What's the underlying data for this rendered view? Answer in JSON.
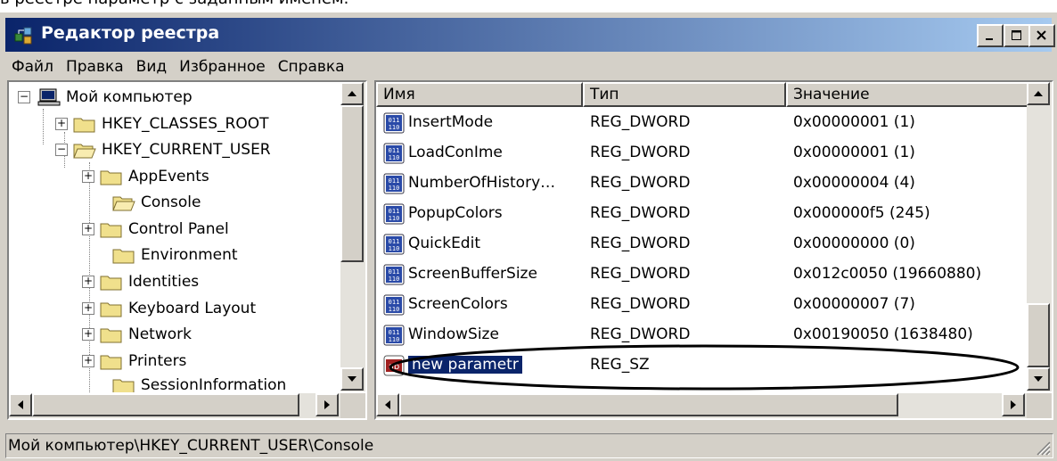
{
  "doc_fragment": "в реестре параметр с заданным именем.",
  "window": {
    "title": "Редактор реестра",
    "controls": {
      "minimize": "_",
      "maximize": "□",
      "close": "×"
    }
  },
  "menu": [
    "Файл",
    "Правка",
    "Вид",
    "Избранное",
    "Справка"
  ],
  "tree": {
    "root": "Мой компьютер",
    "hkcr": "HKEY_CLASSES_ROOT",
    "hkcu": "HKEY_CURRENT_USER",
    "children": [
      "AppEvents",
      "Console",
      "Control Panel",
      "Environment",
      "Identities",
      "Keyboard Layout",
      "Network",
      "Printers",
      "SessionInformation"
    ]
  },
  "list": {
    "headers": {
      "name": "Имя",
      "type": "Тип",
      "value": "Значение"
    },
    "rows": [
      {
        "name": "InsertMode",
        "type": "REG_DWORD",
        "value": "0x00000001 (1)"
      },
      {
        "name": "LoadConIme",
        "type": "REG_DWORD",
        "value": "0x00000001 (1)"
      },
      {
        "name": "NumberOfHistory…",
        "type": "REG_DWORD",
        "value": "0x00000004 (4)"
      },
      {
        "name": "PopupColors",
        "type": "REG_DWORD",
        "value": "0x000000f5 (245)"
      },
      {
        "name": "QuickEdit",
        "type": "REG_DWORD",
        "value": "0x00000000 (0)"
      },
      {
        "name": "ScreenBufferSize",
        "type": "REG_DWORD",
        "value": "0x012c0050 (19660880)"
      },
      {
        "name": "ScreenColors",
        "type": "REG_DWORD",
        "value": "0x00000007 (7)"
      },
      {
        "name": "WindowSize",
        "type": "REG_DWORD",
        "value": "0x00190050 (1638480)"
      }
    ],
    "new_row": {
      "name": "new parametr",
      "type": "REG_SZ",
      "value": ""
    }
  },
  "status": "Мой компьютер\\HKEY_CURRENT_USER\\Console",
  "colors": {
    "title_start": "#0a246a",
    "title_end": "#a6caf0",
    "selection": "#0a246a",
    "face": "#d4d0c8"
  }
}
